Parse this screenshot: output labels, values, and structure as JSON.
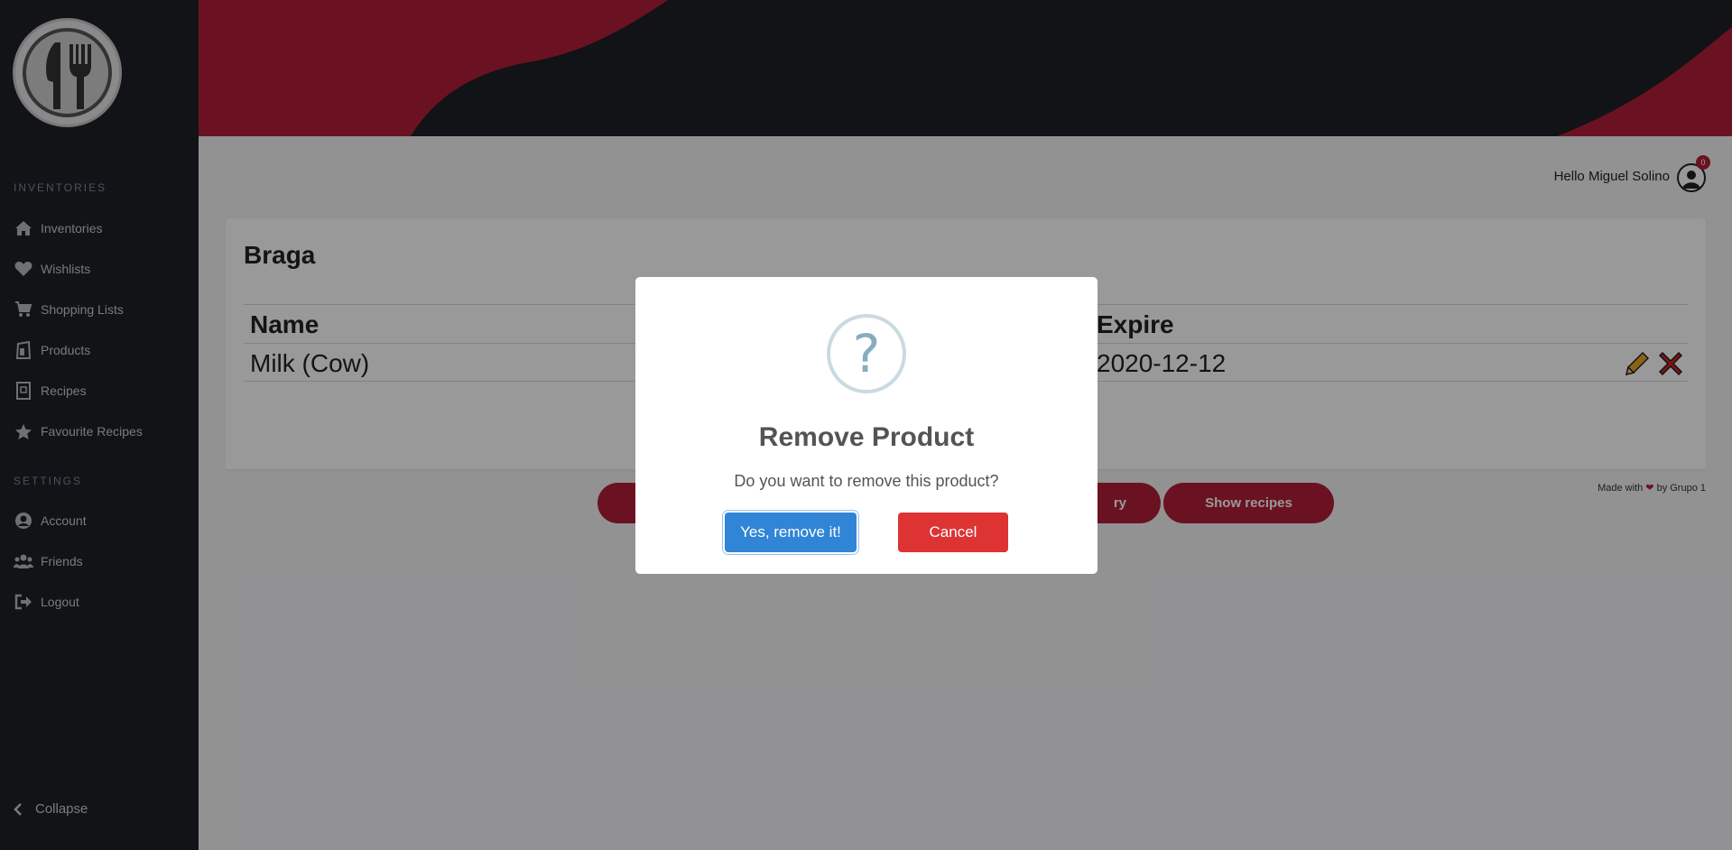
{
  "sidebar": {
    "sections": [
      {
        "title": "INVENTORIES"
      },
      {
        "title": "SETTINGS"
      }
    ],
    "items": [
      {
        "label": "Inventories",
        "icon": "home-icon"
      },
      {
        "label": "Wishlists",
        "icon": "heart-icon"
      },
      {
        "label": "Shopping Lists",
        "icon": "cart-icon"
      },
      {
        "label": "Products",
        "icon": "product-icon"
      },
      {
        "label": "Recipes",
        "icon": "recipe-book-icon"
      },
      {
        "label": "Favourite Recipes",
        "icon": "star-icon"
      },
      {
        "label": "Account",
        "icon": "user-icon"
      },
      {
        "label": "Friends",
        "icon": "users-icon"
      },
      {
        "label": "Logout",
        "icon": "logout-icon"
      }
    ],
    "collapse_label": "Collapse"
  },
  "header": {
    "greeting": "Hello Miguel Solino",
    "notification_count": "0"
  },
  "inventory": {
    "title": "Braga",
    "columns": {
      "name": "Name",
      "expire": "Expire"
    },
    "rows": [
      {
        "name": "Milk (Cow)",
        "expire": "2020-12-12"
      }
    ],
    "buttons": {
      "partial_left": "",
      "partial_middle": "ry",
      "show_recipes": "Show recipes"
    }
  },
  "footer": {
    "made_with": "Made with",
    "heart": "❤",
    "by": "by Grupo 1"
  },
  "modal": {
    "icon": "?",
    "title": "Remove Product",
    "text": "Do you want to remove this product?",
    "confirm": "Yes, remove it!",
    "cancel": "Cancel"
  },
  "colors": {
    "sidebar_bg": "#1d2026",
    "brand_red": "#b11f38",
    "confirm_blue": "#3085d6",
    "cancel_red": "#dd3333"
  }
}
